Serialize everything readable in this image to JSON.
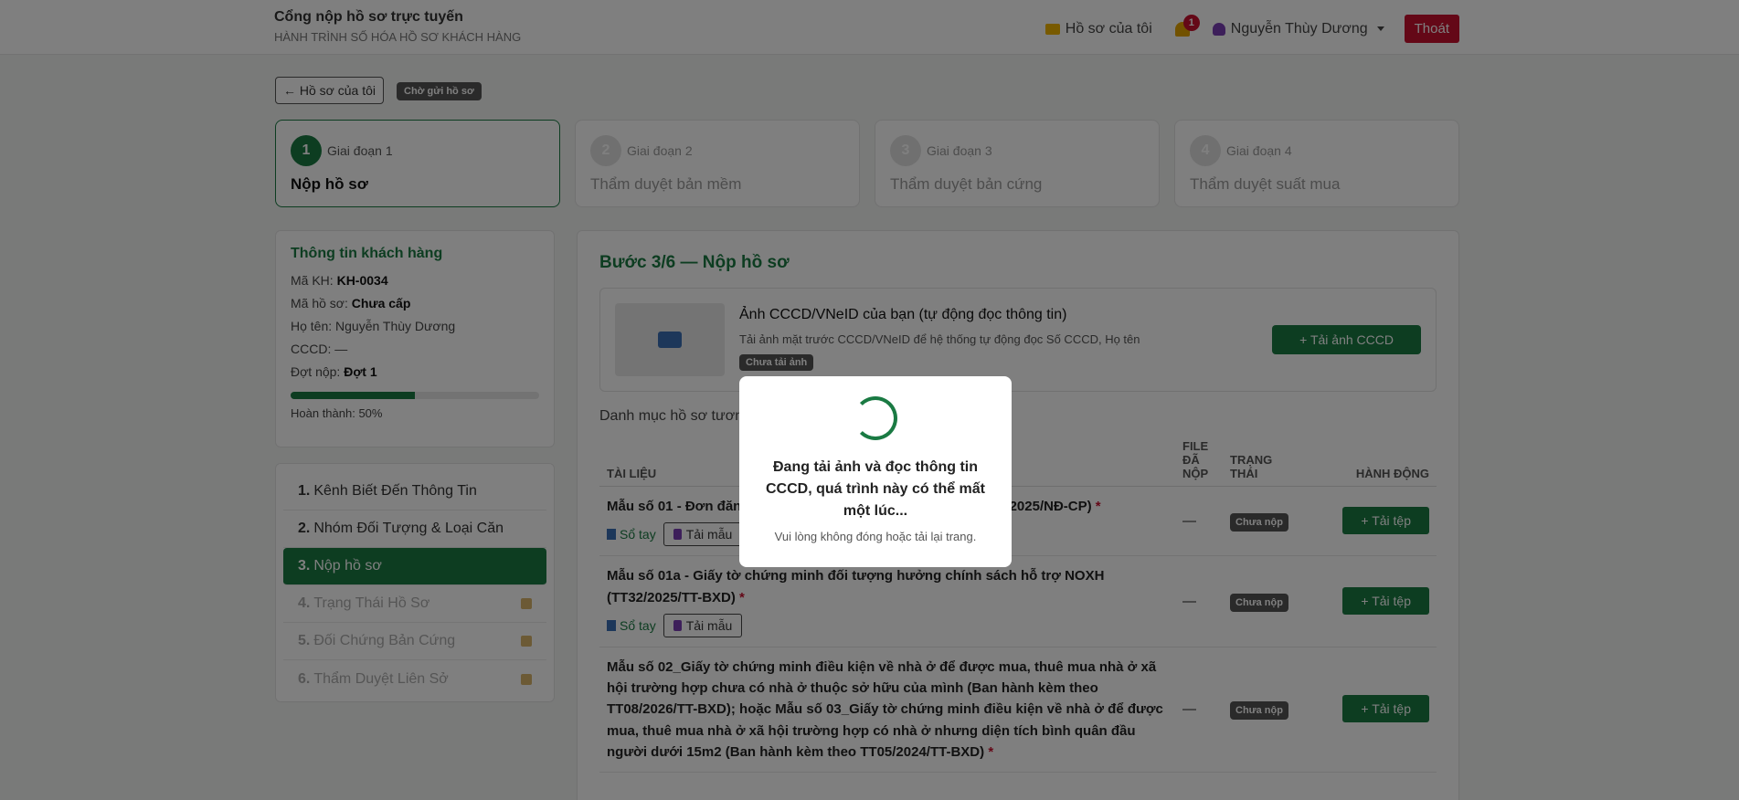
{
  "header": {
    "title": "Cổng nộp hồ sơ trực tuyến",
    "subtitle": "HÀNH TRÌNH SỐ HÓA HỒ SƠ KHÁCH HÀNG",
    "my_files": "Hồ sơ của tôi",
    "notification_count": "1",
    "user_name": "Nguyễn Thùy Dương",
    "logout": "Thoát"
  },
  "toolbar": {
    "back": "← Hồ sơ của tôi",
    "status_chip": "Chờ gửi hồ sơ"
  },
  "stages": [
    {
      "num": "1",
      "label": "Giai đoạn 1",
      "name": "Nộp hồ sơ"
    },
    {
      "num": "2",
      "label": "Giai đoạn 2",
      "name": "Thẩm duyệt bản mềm"
    },
    {
      "num": "3",
      "label": "Giai đoạn 3",
      "name": "Thẩm duyệt bản cứng"
    },
    {
      "num": "4",
      "label": "Giai đoạn 4",
      "name": "Thẩm duyệt suất mua"
    }
  ],
  "customer": {
    "heading": "Thông tin khách hàng",
    "code_label": "Mã KH:",
    "code": "KH-0034",
    "file_label": "Mã hồ sơ:",
    "file": "Chưa cấp",
    "name_label": "Họ tên:",
    "name": "Nguyễn Thùy Dương",
    "cccd_label": "CCCD:",
    "cccd": "—",
    "round_label": "Đợt nộp:",
    "round": "Đợt 1",
    "progress": 0.5,
    "progress_text": "Hoàn thành: 50%"
  },
  "steps": [
    {
      "n": "1.",
      "label": "Kênh Biết Đến Thông Tin"
    },
    {
      "n": "2.",
      "label": "Nhóm Đối Tượng & Loại Căn"
    },
    {
      "n": "3.",
      "label": "Nộp hồ sơ"
    },
    {
      "n": "4.",
      "label": "Trạng Thái Hồ Sơ"
    },
    {
      "n": "5.",
      "label": "Đối Chứng Bản Cứng"
    },
    {
      "n": "6.",
      "label": "Thẩm Duyệt Liên Sở"
    }
  ],
  "main": {
    "heading": "Bước 3/6 — Nộp hồ sơ",
    "cccd_title": "Ảnh CCCD/VNeID của bạn (tự động đọc thông tin)",
    "cccd_desc": "Tải ảnh mặt trước CCCD/VNeID để hệ thống tự động đọc Số CCCD, Họ tên",
    "cccd_status": "Chưa tải ảnh",
    "cccd_upload": "+ Tải ảnh CCCD",
    "intro": "Danh mục hồ sơ tương ứng. Các mục có dấu * là bắt buộc.",
    "columns": {
      "doc": "TÀI LIỆU",
      "file": "FILE ĐÃ NỘP",
      "status": "TRẠNG THÁI",
      "action": "HÀNH ĐỘNG"
    },
    "handbook": "Sổ tay",
    "sample": "Tải mẫu",
    "rows": [
      {
        "doc": "Mẫu số 01 - Đơn đăng ký mua, thuê mua nhà ở xã hội (NĐ100/2025/NĐ-CP)",
        "file": "—",
        "status": "Chưa nộp",
        "action": "+ Tải tệp"
      },
      {
        "doc": "Mẫu số 01a - Giấy tờ chứng minh đối tượng hưởng chính sách hỗ trợ NOXH (TT32/2025/TT-BXD)",
        "file": "—",
        "status": "Chưa nộp",
        "action": "+ Tải tệp"
      },
      {
        "doc": "Mẫu số 02_Giấy tờ chứng minh điều kiện về nhà ở để được mua, thuê mua nhà ở xã hội trường hợp chưa có nhà ở thuộc sở hữu của mình (Ban hành kèm theo TT08/2026/TT-BXD); hoặc Mẫu số 03_Giấy tờ chứng minh điều kiện về nhà ở để được mua, thuê mua nhà ở xã hội trường hợp có nhà ở nhưng diện tích bình quân đầu người dưới 15m2 (Ban hành kèm theo TT05/2024/TT-BXD)",
        "file": "—",
        "status": "Chưa nộp",
        "action": "+ Tải tệp"
      }
    ]
  },
  "modal": {
    "message": "Đang tải ảnh và đọc thông tin CCCD, quá trình này có thể mất một lúc...",
    "note": "Vui lòng không đóng hoặc tải lại trang."
  }
}
